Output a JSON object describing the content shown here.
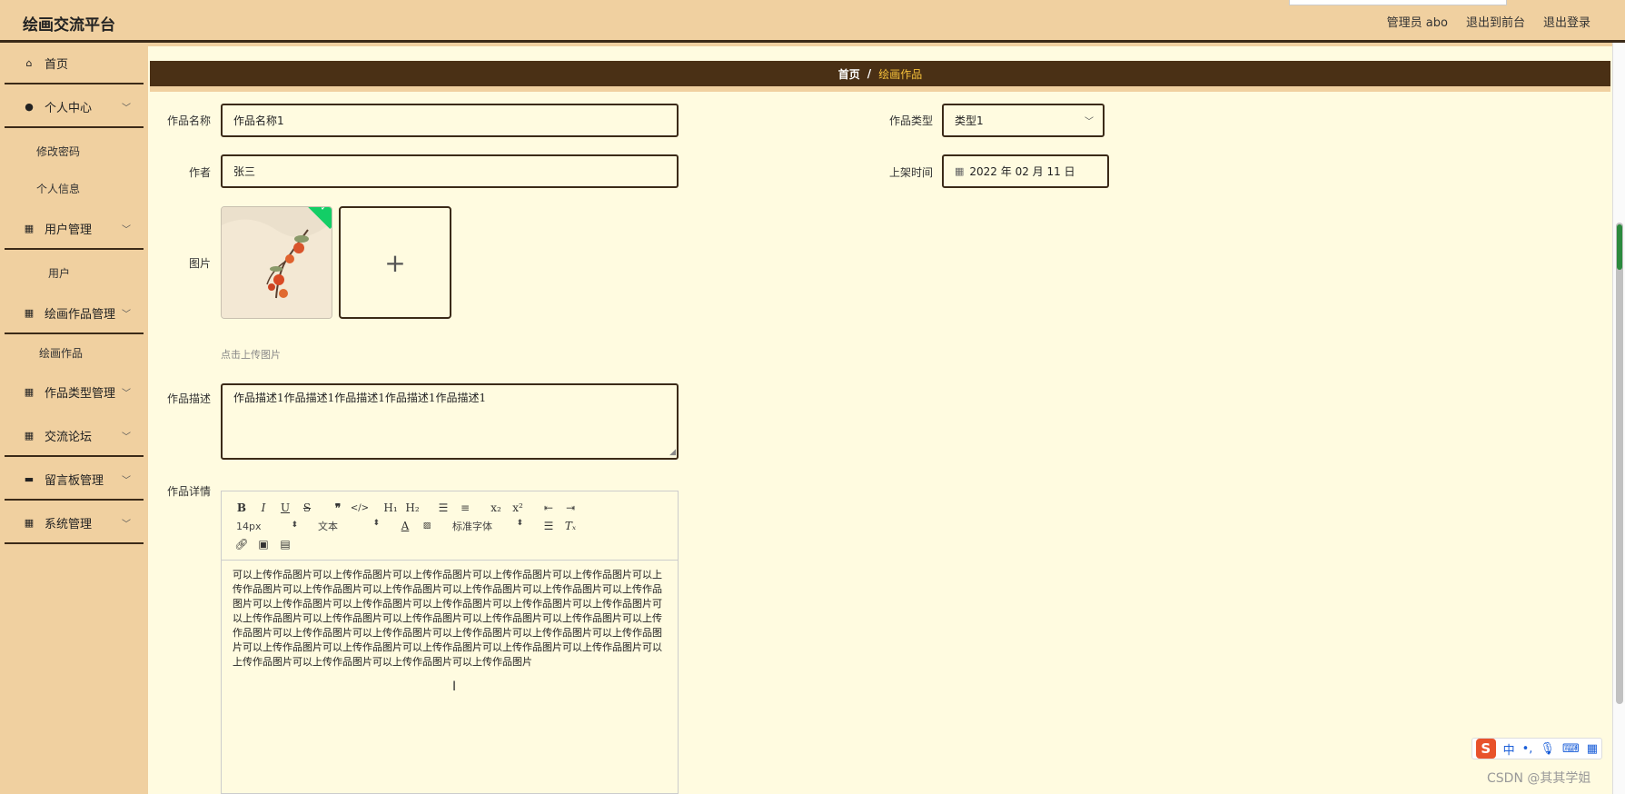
{
  "header": {
    "app_title": "绘画交流平台",
    "admin_label": "管理员 abo",
    "back_to_front": "退出到前台",
    "logout": "退出登录"
  },
  "sidebar": {
    "home": "首页",
    "personal_center": "个人中心",
    "change_password": "修改密码",
    "personal_info": "个人信息",
    "user_management": "用户管理",
    "user": "用户",
    "artwork_management": "绘画作品管理",
    "artwork": "绘画作品",
    "type_management": "作品类型管理",
    "forum": "交流论坛",
    "message_board": "留言板管理",
    "system_management": "系统管理"
  },
  "breadcrumb": {
    "home": "首页",
    "separator": "/",
    "current": "绘画作品"
  },
  "form": {
    "name_label": "作品名称",
    "name_value": "作品名称1",
    "type_label": "作品类型",
    "type_value": "类型1",
    "author_label": "作者",
    "author_value": "张三",
    "shelf_time_label": "上架时间",
    "shelf_time_value": "2022 年 02 月 11 日",
    "image_label": "图片",
    "upload_hint": "点击上传图片",
    "desc_label": "作品描述",
    "desc_value": "作品描述1作品描述1作品描述1作品描述1作品描述1",
    "detail_label": "作品详情"
  },
  "editor": {
    "size_select": "14px",
    "text_select": "文本",
    "font_select": "标准字体",
    "content": "可以上传作品图片可以上传作品图片可以上传作品图片可以上传作品图片可以上传作品图片可以上传作品图片可以上传作品图片可以上传作品图片可以上传作品图片可以上传作品图片可以上传作品图片可以上传作品图片可以上传作品图片可以上传作品图片可以上传作品图片可以上传作品图片可以上传作品图片可以上传作品图片可以上传作品图片可以上传作品图片可以上传作品图片可以上传作品图片可以上传作品图片可以上传作品图片可以上传作品图片可以上传作品图片可以上传作品图片可以上传作品图片可以上传作品图片可以上传作品图片可以上传作品图片可以上传作品图片可以上传作品图片可以上传作品图片可以上传作品图片可以上传作品图片"
  },
  "ime": {
    "lang": "中",
    "punct": "•,"
  },
  "watermark": "CSDN @其其学姐",
  "colors": {
    "sidebar_bg": "#f0d0a0",
    "breadcrumb_bg": "#4a3015",
    "accent": "#f7c23b",
    "content_bg": "#fffbe0",
    "border": "#3b2a18"
  }
}
